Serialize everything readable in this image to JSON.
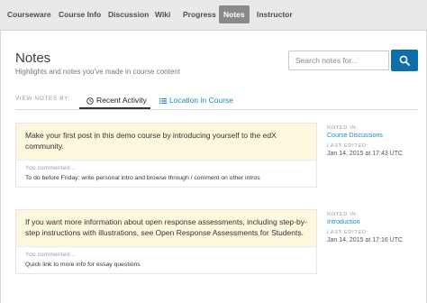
{
  "nav": {
    "tabs": [
      {
        "label": "Courseware"
      },
      {
        "label": "Course Info"
      },
      {
        "label": "Discussion"
      },
      {
        "label": "Wiki"
      },
      {
        "label": "Progress"
      },
      {
        "label": "Notes",
        "active": true
      },
      {
        "label": "Instructor"
      }
    ]
  },
  "header": {
    "title": "Notes",
    "subtitle": "Highlights and notes you've made in course content"
  },
  "search": {
    "placeholder": "Search notes for...",
    "value": "",
    "button_icon": "search-icon"
  },
  "view_by": {
    "label": "VIEW NOTES BY:",
    "tabs": [
      {
        "label": "Recent Activity",
        "icon": "clock-icon",
        "active": true
      },
      {
        "label": "Location in Course",
        "icon": "list-icon",
        "active": false
      }
    ]
  },
  "notes": [
    {
      "text": "Make your first post in this demo course by introducing yourself to the edX community.",
      "comment_label": "You commented...",
      "comment": "To do before Friday: write personal intro and browse through / comment on other intros",
      "noted_in_label": "NOTED IN:",
      "noted_in": "Course Discussions",
      "last_edited_label": "LAST EDITED:",
      "last_edited": "Jan 14, 2015 at 17:43 UTC"
    },
    {
      "text": "If you want more information about open response assessments, including step-by-step instructions with illustrations, see Open Response Assessments for Students.",
      "comment_label": "You commented...",
      "comment": "Quick link to more info for essay questions",
      "noted_in_label": "NOTED IN:",
      "noted_in": "Introduction",
      "last_edited_label": "LAST EDITED:",
      "last_edited": "Jan 14, 2015 at 17:16 UTC"
    }
  ],
  "colors": {
    "accent": "#0e6fa6",
    "link": "#1a8ac4",
    "highlight": "#fcf8de",
    "nav_bg": "#e9e9e9",
    "active_tab": "#8a8a8a"
  }
}
